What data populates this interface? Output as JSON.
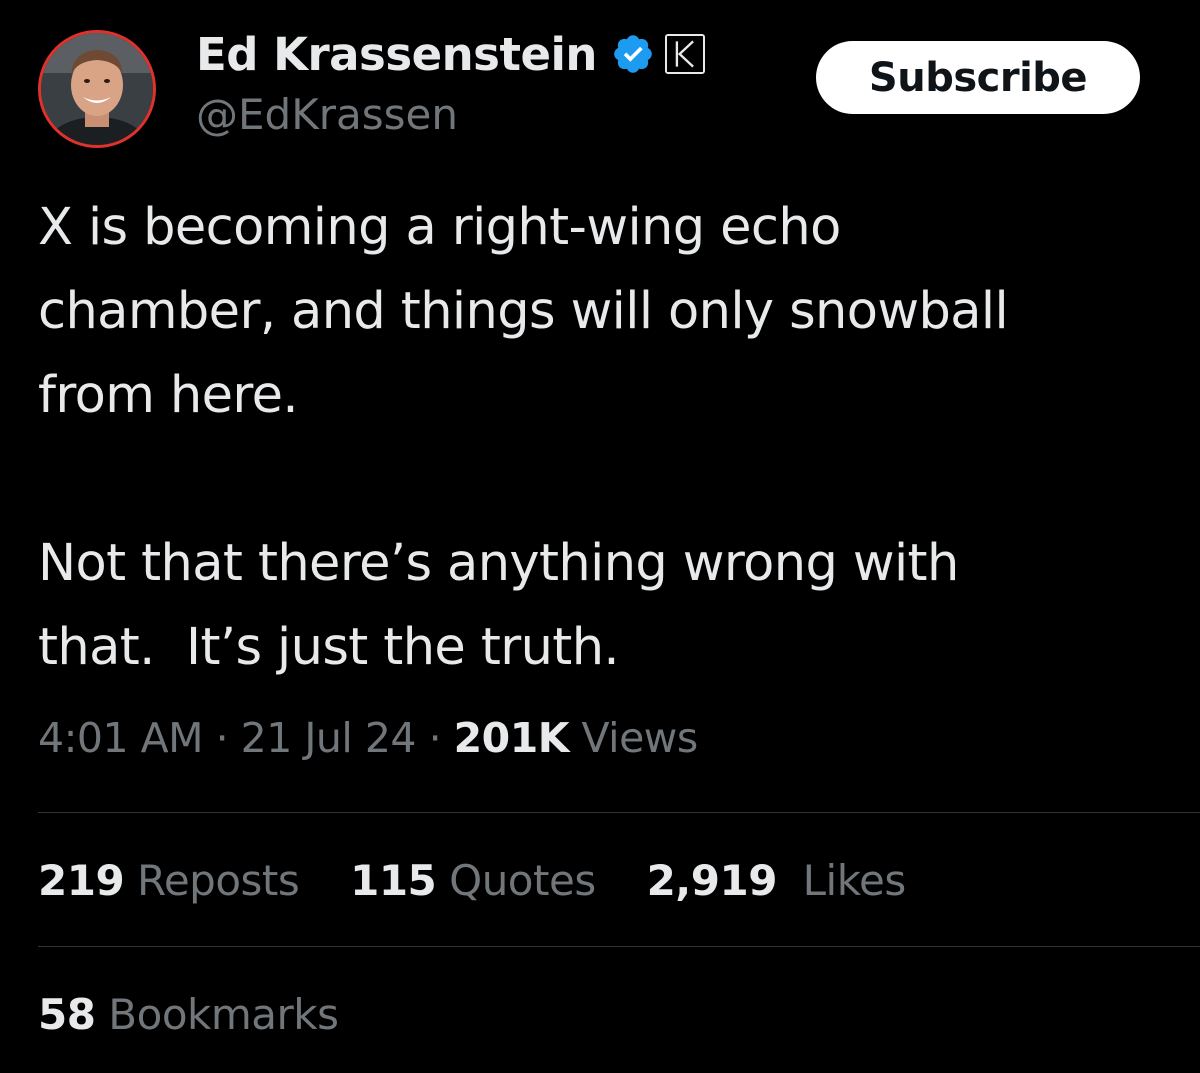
{
  "author": {
    "display_name": "Ed Krassenstein",
    "handle": "@EdKrassen",
    "avatar_icon": "profile-photo",
    "verified_icon": "verified-badge-icon",
    "affiliate_icon": "affiliate-badge-icon",
    "affiliate_letter": "K"
  },
  "subscribe_label": "Subscribe",
  "tweet": {
    "paragraphs": [
      "X is becoming a right-wing echo\nchamber, and things will only snowball\nfrom here.",
      "Not that there’s anything wrong with\nthat.  It’s just the truth."
    ]
  },
  "meta": {
    "time": "4:01 AM",
    "separator": " · ",
    "date": "21 Jul 24",
    "views_count": "201K",
    "views_label": " Views"
  },
  "stats": [
    {
      "count": "219",
      "label": " Reposts"
    },
    {
      "count": "115",
      "label": " Quotes"
    },
    {
      "count": "2,919",
      "label": "  Likes"
    }
  ],
  "bookmarks": {
    "count": "58",
    "label": " Bookmarks"
  },
  "colors": {
    "background": "#000000",
    "text_primary": "#e7e9ea",
    "text_secondary": "#71767b",
    "verified_blue": "#1d9bf0",
    "avatar_ring": "#e0312b",
    "divider": "#2f3336"
  }
}
